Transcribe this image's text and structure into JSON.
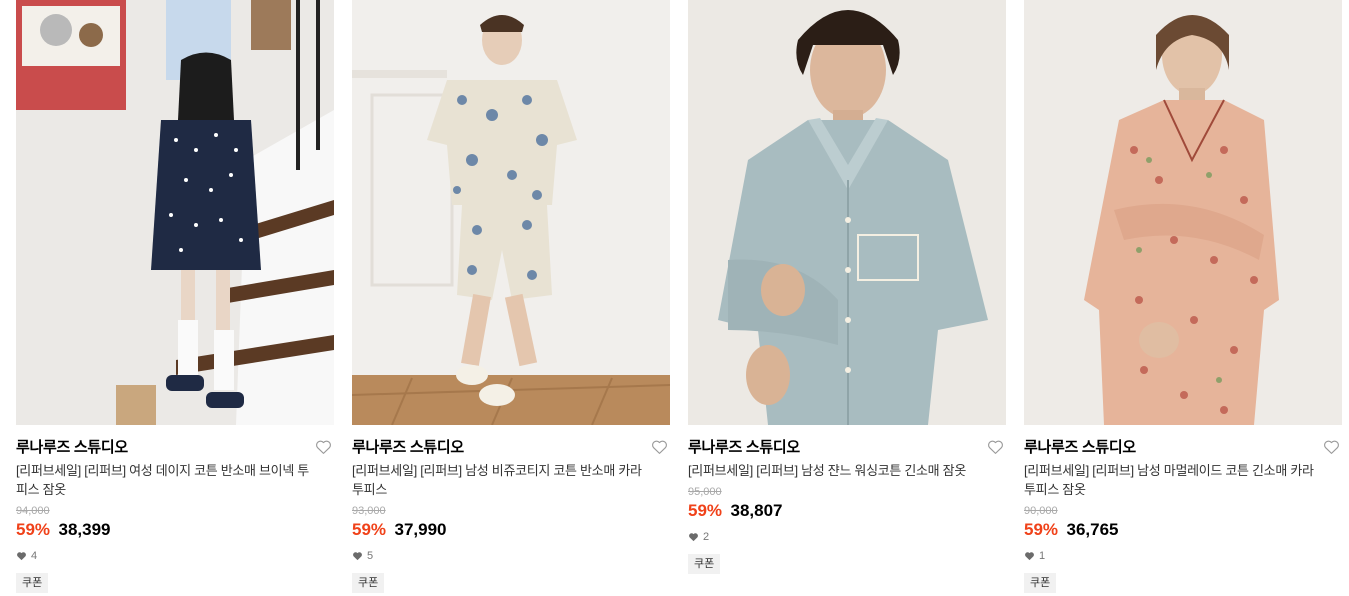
{
  "colors": {
    "discount": "#f0421a",
    "original_price": "#a9a9a9",
    "coupon_bg": "#f1f1f1"
  },
  "products": [
    {
      "brand": "루나루즈 스튜디오",
      "name": "[리퍼브세일] [리퍼브] 여성 데이지 코튼 반소매 브이넥 투피스 잠옷",
      "original_price": "94,000",
      "discount_rate": "59%",
      "price": "38,399",
      "likes": "4",
      "coupon": "쿠폰",
      "image_icon": "product-photo-woman-polka-dot-pajama",
      "heart_icon": "heart-outline-icon"
    },
    {
      "brand": "루나루즈 스튜디오",
      "name": "[리퍼브세일] [리퍼브] 남성 비쥬코티지 코튼 반소매 카라 투피스",
      "original_price": "93,000",
      "discount_rate": "59%",
      "price": "37,990",
      "likes": "5",
      "coupon": "쿠폰",
      "image_icon": "product-photo-man-toile-short-pajama",
      "heart_icon": "heart-outline-icon"
    },
    {
      "brand": "루나루즈 스튜디오",
      "name": "[리퍼브세일] [리퍼브] 남성 쟌느 워싱코튼 긴소매 잠옷",
      "original_price": "95,000",
      "discount_rate": "59%",
      "price": "38,807",
      "likes": "2",
      "coupon": "쿠폰",
      "image_icon": "product-photo-man-blue-long-pajama",
      "heart_icon": "heart-outline-icon"
    },
    {
      "brand": "루나루즈 스튜디오",
      "name": "[리퍼브세일] [리퍼브] 남성 마멀레이드 코튼 긴소매 카라 투피스 잠옷",
      "original_price": "90,000",
      "discount_rate": "59%",
      "price": "36,765",
      "likes": "1",
      "coupon": "쿠폰",
      "image_icon": "product-photo-man-floral-pajama",
      "heart_icon": "heart-outline-icon"
    }
  ]
}
